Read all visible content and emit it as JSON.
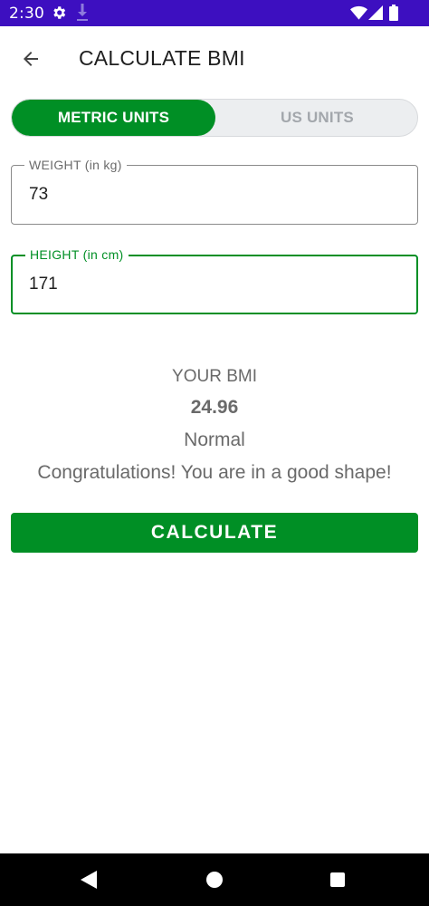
{
  "status_bar": {
    "time": "2:30",
    "icons": [
      "gear-icon",
      "download-icon",
      "wifi-icon",
      "signal-icon",
      "battery-icon"
    ],
    "background": "#3d0fc0"
  },
  "app_bar": {
    "title": "CALCULATE BMI",
    "back_icon": "arrow-left-icon"
  },
  "unit_toggle": {
    "options": [
      {
        "label": "METRIC UNITS",
        "selected": true
      },
      {
        "label": "US UNITS",
        "selected": false
      }
    ],
    "accent": "#008f25"
  },
  "form": {
    "weight": {
      "label": "WEIGHT (in kg)",
      "value": "73"
    },
    "height": {
      "label": "HEIGHT (in cm)",
      "value": "171",
      "focused": true
    }
  },
  "result": {
    "label": "YOUR BMI",
    "value": "24.96",
    "category": "Normal",
    "message": "Congratulations! You are in a good shape!"
  },
  "calculate_button": {
    "label": "CALCULATE"
  },
  "nav_bar": {
    "icons": [
      "back-triangle-icon",
      "home-circle-icon",
      "recents-square-icon"
    ]
  }
}
